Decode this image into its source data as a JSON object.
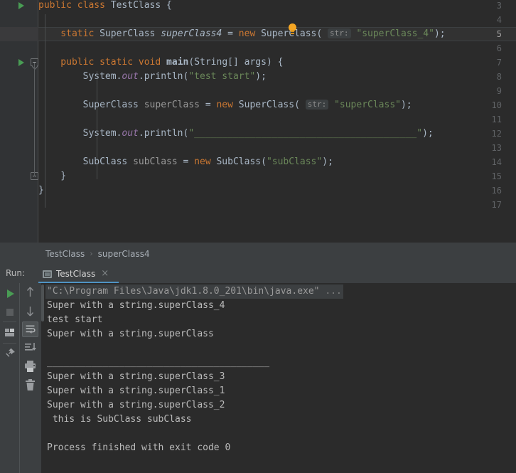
{
  "editor": {
    "first_visible_partial_line": "2",
    "current_line": 5,
    "lines": [
      {
        "num": "3",
        "has_run_arrow": true,
        "fold": "none",
        "tokens": [
          {
            "t": "public",
            "c": "kw"
          },
          {
            "t": " ",
            "c": "plain"
          },
          {
            "t": "class",
            "c": "kw"
          },
          {
            "t": " ",
            "c": "plain"
          },
          {
            "t": "TestClass",
            "c": "type"
          },
          {
            "t": " {",
            "c": "punct"
          }
        ]
      },
      {
        "num": "4",
        "has_run_arrow": false,
        "fold": "none",
        "tokens": []
      },
      {
        "num": "5",
        "has_run_arrow": false,
        "fold": "none",
        "tokens": [
          {
            "t": "    static",
            "c": "kw"
          },
          {
            "t": " ",
            "c": "plain"
          },
          {
            "t": "SuperClass",
            "c": "type"
          },
          {
            "t": " ",
            "c": "plain"
          },
          {
            "t": "superClass4",
            "c": "stat"
          },
          {
            "t": " = ",
            "c": "punct"
          },
          {
            "t": "new",
            "c": "kw"
          },
          {
            "t": " ",
            "c": "plain"
          },
          {
            "t": "SuperClass",
            "c": "type"
          },
          {
            "t": "(",
            "c": "punct"
          },
          {
            "t": " ",
            "c": "plain"
          },
          {
            "t": "str:",
            "c": "hint"
          },
          {
            "t": " ",
            "c": "plain"
          },
          {
            "t": "\"superClass_4\"",
            "c": "str"
          },
          {
            "t": ");",
            "c": "punct"
          }
        ]
      },
      {
        "num": "6",
        "has_run_arrow": false,
        "fold": "none",
        "tokens": []
      },
      {
        "num": "7",
        "has_run_arrow": true,
        "fold": "start",
        "tokens": [
          {
            "t": "    public",
            "c": "kw"
          },
          {
            "t": " ",
            "c": "plain"
          },
          {
            "t": "static",
            "c": "kw"
          },
          {
            "t": " ",
            "c": "plain"
          },
          {
            "t": "void",
            "c": "kw"
          },
          {
            "t": " ",
            "c": "plain"
          },
          {
            "t": "main",
            "c": "mname"
          },
          {
            "t": "(",
            "c": "punct"
          },
          {
            "t": "String",
            "c": "type"
          },
          {
            "t": "[] args) {",
            "c": "punct"
          }
        ]
      },
      {
        "num": "8",
        "has_run_arrow": false,
        "fold": "none",
        "tokens": [
          {
            "t": "        System",
            "c": "type"
          },
          {
            "t": ".",
            "c": "punct"
          },
          {
            "t": "out",
            "c": "fld"
          },
          {
            "t": ".println(",
            "c": "punct"
          },
          {
            "t": "\"test start\"",
            "c": "str"
          },
          {
            "t": ");",
            "c": "punct"
          }
        ]
      },
      {
        "num": "9",
        "has_run_arrow": false,
        "fold": "none",
        "tokens": []
      },
      {
        "num": "10",
        "has_run_arrow": false,
        "fold": "none",
        "tokens": [
          {
            "t": "        SuperClass",
            "c": "type"
          },
          {
            "t": " ",
            "c": "plain"
          },
          {
            "t": "superClass",
            "c": "grayv"
          },
          {
            "t": " = ",
            "c": "punct"
          },
          {
            "t": "new",
            "c": "kw"
          },
          {
            "t": " ",
            "c": "plain"
          },
          {
            "t": "SuperClass",
            "c": "type"
          },
          {
            "t": "(",
            "c": "punct"
          },
          {
            "t": " ",
            "c": "plain"
          },
          {
            "t": "str:",
            "c": "hint"
          },
          {
            "t": " ",
            "c": "plain"
          },
          {
            "t": "\"superClass\"",
            "c": "str"
          },
          {
            "t": ");",
            "c": "punct"
          }
        ]
      },
      {
        "num": "11",
        "has_run_arrow": false,
        "fold": "none",
        "tokens": []
      },
      {
        "num": "12",
        "has_run_arrow": false,
        "fold": "none",
        "tokens": [
          {
            "t": "        System",
            "c": "type"
          },
          {
            "t": ".",
            "c": "punct"
          },
          {
            "t": "out",
            "c": "fld"
          },
          {
            "t": ".println(",
            "c": "punct"
          },
          {
            "t": "\"________________________________________\"",
            "c": "str"
          },
          {
            "t": ");",
            "c": "punct"
          }
        ]
      },
      {
        "num": "13",
        "has_run_arrow": false,
        "fold": "none",
        "tokens": []
      },
      {
        "num": "14",
        "has_run_arrow": false,
        "fold": "none",
        "tokens": [
          {
            "t": "        SubClass",
            "c": "type"
          },
          {
            "t": " ",
            "c": "plain"
          },
          {
            "t": "subClass",
            "c": "grayv"
          },
          {
            "t": " = ",
            "c": "punct"
          },
          {
            "t": "new",
            "c": "kw"
          },
          {
            "t": " ",
            "c": "plain"
          },
          {
            "t": "SubClass",
            "c": "type"
          },
          {
            "t": "(",
            "c": "punct"
          },
          {
            "t": "\"subClass\"",
            "c": "str"
          },
          {
            "t": ");",
            "c": "punct"
          }
        ]
      },
      {
        "num": "15",
        "has_run_arrow": false,
        "fold": "end",
        "tokens": [
          {
            "t": "    }",
            "c": "punct"
          }
        ]
      },
      {
        "num": "16",
        "has_run_arrow": false,
        "fold": "none",
        "tokens": [
          {
            "t": "}",
            "c": "punct"
          }
        ]
      },
      {
        "num": "17",
        "has_run_arrow": false,
        "fold": "none",
        "tokens": []
      }
    ]
  },
  "breadcrumb": {
    "items": [
      "TestClass",
      "superClass4"
    ],
    "separator": "›"
  },
  "run_panel": {
    "title": "Run:",
    "tab": {
      "label": "TestClass",
      "close": "×",
      "icon": "run-configuration-icon"
    },
    "toolbar_left": [
      {
        "name": "rerun-button",
        "icon": "play-icon"
      },
      {
        "name": "stop-button",
        "icon": "stop-icon"
      },
      {
        "name": "layout-settings-button",
        "icon": "layout-icon"
      },
      {
        "name": "pin-tab-button",
        "icon": "pin-icon"
      }
    ],
    "toolbar_right": [
      {
        "name": "up-the-stack-trace-button",
        "icon": "arrow-up-icon",
        "selected": false
      },
      {
        "name": "down-the-stack-trace-button",
        "icon": "arrow-down-icon",
        "selected": false
      },
      {
        "name": "soft-wrap-button",
        "icon": "soft-wrap-icon",
        "selected": true
      },
      {
        "name": "scroll-to-end-button",
        "icon": "scroll-to-end-icon",
        "selected": false
      },
      {
        "name": "print-button",
        "icon": "printer-icon",
        "selected": false
      },
      {
        "name": "clear-all-button",
        "icon": "trash-icon",
        "selected": false
      }
    ],
    "console_lines": [
      {
        "text": "\"C:\\Program Files\\Java\\jdk1.8.0_201\\bin\\java.exe\"",
        "trailing": " ...",
        "style": "cmd"
      },
      {
        "text": "Super with a string.superClass_4",
        "style": "normal"
      },
      {
        "text": "test start",
        "style": "normal"
      },
      {
        "text": "Super with a string.superClass",
        "style": "normal"
      },
      {
        "text": "",
        "style": "normal"
      },
      {
        "text": "________________________________________",
        "style": "normal"
      },
      {
        "text": "Super with a string.superClass_3",
        "style": "normal"
      },
      {
        "text": "Super with a string.superClass_1",
        "style": "normal"
      },
      {
        "text": "Super with a string.superClass_2",
        "style": "normal"
      },
      {
        "text": " this is SubClass subClass",
        "style": "normal"
      },
      {
        "text": "",
        "style": "normal"
      },
      {
        "text": "Process finished with exit code 0",
        "style": "normal"
      }
    ]
  },
  "colors": {
    "editor_bg": "#2b2b2b",
    "gutter_bg": "#313335",
    "panel_bg": "#3c3f41",
    "keyword": "#cc7832",
    "string": "#6a8759",
    "field": "#9876aa",
    "text": "#a9b7c6",
    "run_green": "#499c54",
    "tab_accent": "#4f93c4",
    "bulb": "#f5a623"
  }
}
